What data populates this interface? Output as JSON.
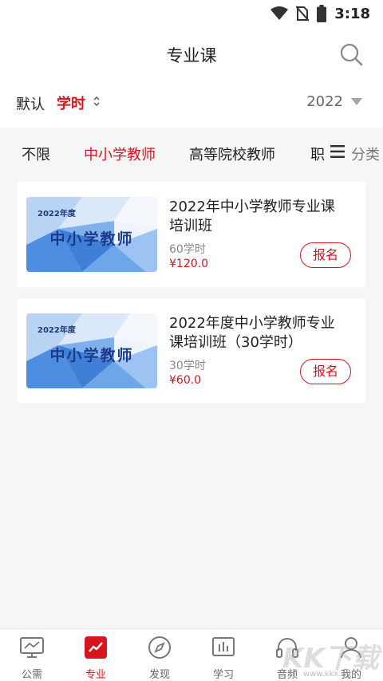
{
  "status_bar": {
    "time": "3:18"
  },
  "header": {
    "title": "专业课"
  },
  "sort_bar": {
    "default_label": "默认",
    "hours_label": "学时",
    "year": "2022"
  },
  "category_tabs": {
    "items": [
      "不限",
      "中小学教师",
      "高等院校教师",
      "职"
    ],
    "active_index": 1,
    "classify_label": "分类"
  },
  "courses": [
    {
      "thumb_year": "2022年度",
      "thumb_title": "中小学教师",
      "title": "2022年中小学教师专业课培训班",
      "hours": "60学时",
      "price": "¥120.0",
      "enroll_label": "报名"
    },
    {
      "thumb_year": "2022年度",
      "thumb_title": "中小学教师",
      "title": "2022年度中小学教师专业课培训班（30学时）",
      "hours": "30学时",
      "price": "¥60.0",
      "enroll_label": "报名"
    }
  ],
  "tab_bar": {
    "items": [
      {
        "label": "公需",
        "icon": "monitor-icon"
      },
      {
        "label": "专业",
        "icon": "trend-chart-icon"
      },
      {
        "label": "发现",
        "icon": "compass-icon"
      },
      {
        "label": "学习",
        "icon": "bar-chart-icon"
      },
      {
        "label": "音频",
        "icon": "headphones-icon"
      },
      {
        "label": "我的",
        "icon": "user-icon"
      }
    ],
    "active_index": 1
  },
  "watermark": {
    "main": "KK下载",
    "sub": "www.kkx.net"
  },
  "colors": {
    "accent": "#d8141e",
    "background": "#f6f6f6",
    "thumb_blue": "#3f7fd8"
  }
}
